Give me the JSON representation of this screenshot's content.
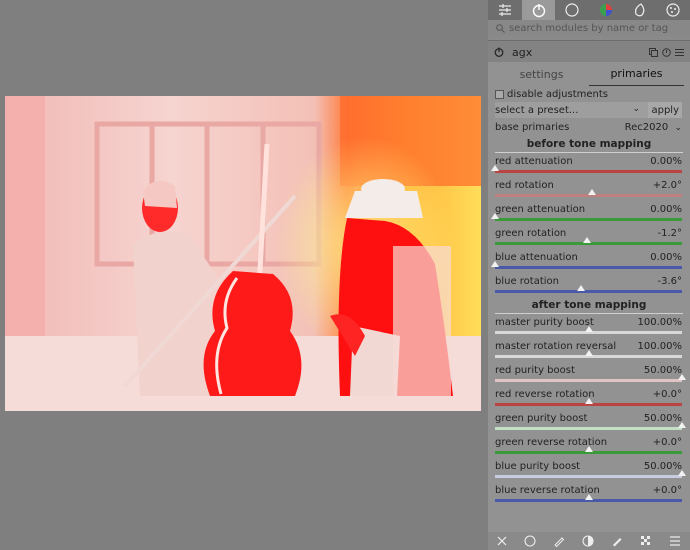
{
  "search": {
    "placeholder": "search modules by name or tag"
  },
  "module": {
    "name": "agx"
  },
  "subtabs": [
    {
      "label": "settings"
    },
    {
      "label": "primaries"
    }
  ],
  "disable_adjustments": {
    "label": "disable adjustments",
    "checked": false
  },
  "preset": {
    "placeholder": "select a preset...",
    "apply_label": "apply"
  },
  "base_primaries": {
    "label": "base primaries",
    "value": "Rec2020"
  },
  "sections": {
    "before": "before tone mapping",
    "after": "after tone mapping"
  },
  "before_sliders": [
    {
      "label": "red attenuation",
      "value": "0.00%",
      "pos": 0.0,
      "color": "#b84444"
    },
    {
      "label": "red rotation",
      "value": "+2.0°",
      "pos": 0.52,
      "color": "#c08080"
    },
    {
      "label": "green attenuation",
      "value": "0.00%",
      "pos": 0.0,
      "color": "#3a9a3a"
    },
    {
      "label": "green rotation",
      "value": "-1.2°",
      "pos": 0.49,
      "color": "#3a9a3a"
    },
    {
      "label": "blue attenuation",
      "value": "0.00%",
      "pos": 0.0,
      "color": "#4a5aa8"
    },
    {
      "label": "blue rotation",
      "value": "-3.6°",
      "pos": 0.46,
      "color": "#4a5aa8"
    }
  ],
  "after_sliders": [
    {
      "label": "master purity boost",
      "value": "100.00%",
      "pos": 0.5,
      "color": "#d8d8d8"
    },
    {
      "label": "master rotation reversal",
      "value": "100.00%",
      "pos": 0.5,
      "color": "#d8d8d8"
    },
    {
      "label": "red purity boost",
      "value": "50.00%",
      "pos": 1.0,
      "color": "#e0c4c4"
    },
    {
      "label": "red reverse rotation",
      "value": "+0.0°",
      "pos": 0.5,
      "color": "#b84444"
    },
    {
      "label": "green purity boost",
      "value": "50.00%",
      "pos": 1.0,
      "color": "#c4e0c4"
    },
    {
      "label": "green reverse rotation",
      "value": "+0.0°",
      "pos": 0.5,
      "color": "#3a9a3a"
    },
    {
      "label": "blue purity boost",
      "value": "50.00%",
      "pos": 1.0,
      "color": "#c8cce0"
    },
    {
      "label": "blue reverse rotation",
      "value": "+0.0°",
      "pos": 0.5,
      "color": "#4a5aa8"
    }
  ]
}
